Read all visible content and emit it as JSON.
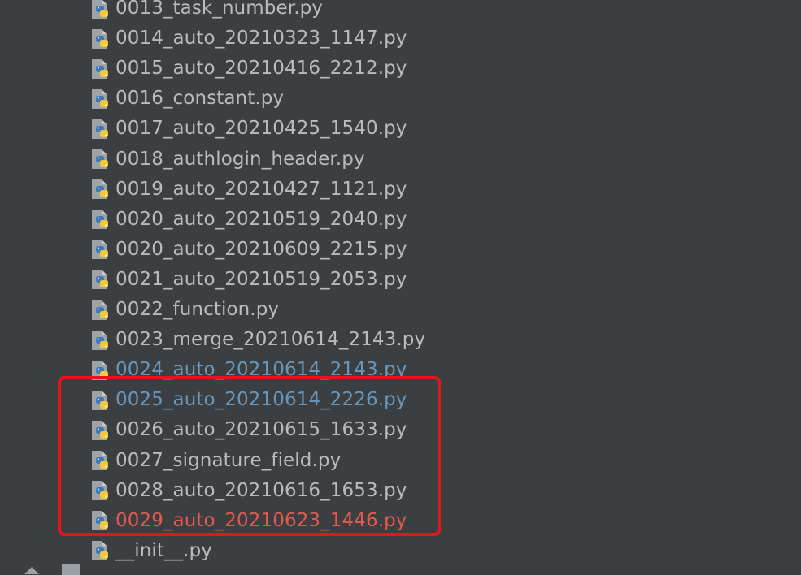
{
  "tree": {
    "files": [
      {
        "name": "0013_task_number.py",
        "status": "normal"
      },
      {
        "name": "0014_auto_20210323_1147.py",
        "status": "normal"
      },
      {
        "name": "0015_auto_20210416_2212.py",
        "status": "normal"
      },
      {
        "name": "0016_constant.py",
        "status": "normal"
      },
      {
        "name": "0017_auto_20210425_1540.py",
        "status": "normal"
      },
      {
        "name": "0018_authlogin_header.py",
        "status": "normal"
      },
      {
        "name": "0019_auto_20210427_1121.py",
        "status": "normal"
      },
      {
        "name": "0020_auto_20210519_2040.py",
        "status": "normal"
      },
      {
        "name": "0020_auto_20210609_2215.py",
        "status": "normal"
      },
      {
        "name": "0021_auto_20210519_2053.py",
        "status": "normal"
      },
      {
        "name": "0022_function.py",
        "status": "normal"
      },
      {
        "name": "0023_merge_20210614_2143.py",
        "status": "normal"
      },
      {
        "name": "0024_auto_20210614_2143.py",
        "status": "modified"
      },
      {
        "name": "0025_auto_20210614_2226.py",
        "status": "modified"
      },
      {
        "name": "0026_auto_20210615_1633.py",
        "status": "normal"
      },
      {
        "name": "0027_signature_field.py",
        "status": "normal"
      },
      {
        "name": "0028_auto_20210616_1653.py",
        "status": "normal"
      },
      {
        "name": "0029_auto_20210623_1446.py",
        "status": "conflict"
      },
      {
        "name": "__init__.py",
        "status": "normal"
      }
    ],
    "icon": "python-file-icon",
    "colors": {
      "background": "#3c3f41",
      "normal_text": "#bbbbbb",
      "modified_text": "#6897bb",
      "conflict_text": "#e05a4f",
      "highlight_box": "#e8141c"
    }
  }
}
